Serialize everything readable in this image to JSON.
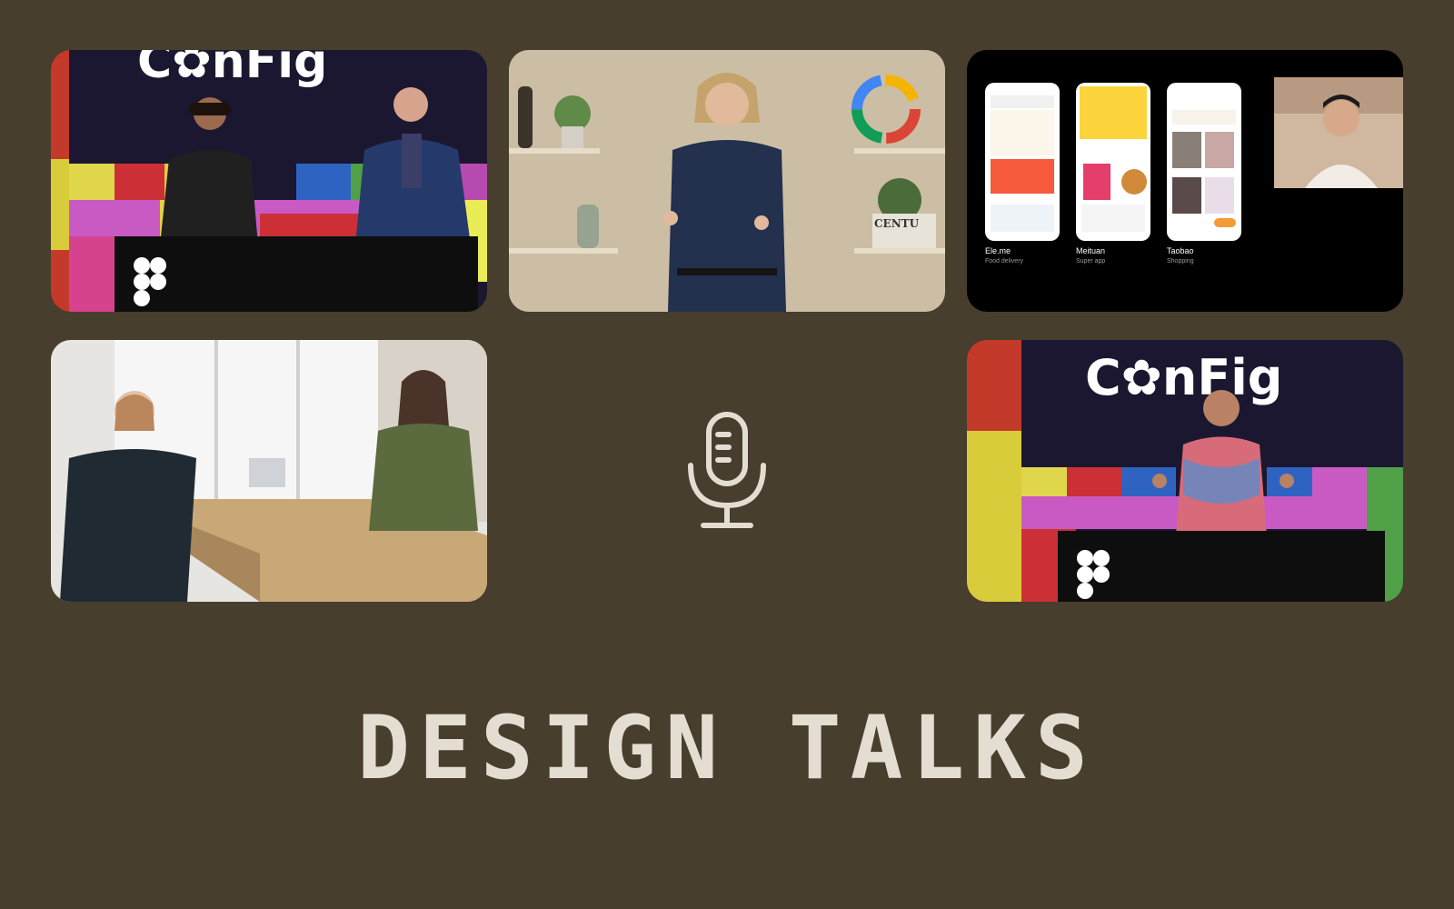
{
  "page": {
    "background": "#473e2d",
    "accent_text_color": "#e3ddd2"
  },
  "tiles": [
    {
      "id": "config-stage-duo",
      "description_icon": "video-thumbnail"
    },
    {
      "id": "google-presenter",
      "description_icon": "video-thumbnail"
    },
    {
      "id": "app-showcase",
      "description_icon": "video-thumbnail",
      "apps": [
        {
          "name": "Ele.me",
          "category": "Food delivery"
        },
        {
          "name": "Meituan",
          "category": "Super app"
        },
        {
          "name": "Taobao",
          "category": "Shopping"
        }
      ]
    },
    {
      "id": "office-duo",
      "description_icon": "video-thumbnail"
    },
    {
      "id": "config-stage-solo",
      "description_icon": "video-thumbnail"
    }
  ],
  "center_icon": "microphone-icon",
  "headline": "DESIGN TALKS"
}
